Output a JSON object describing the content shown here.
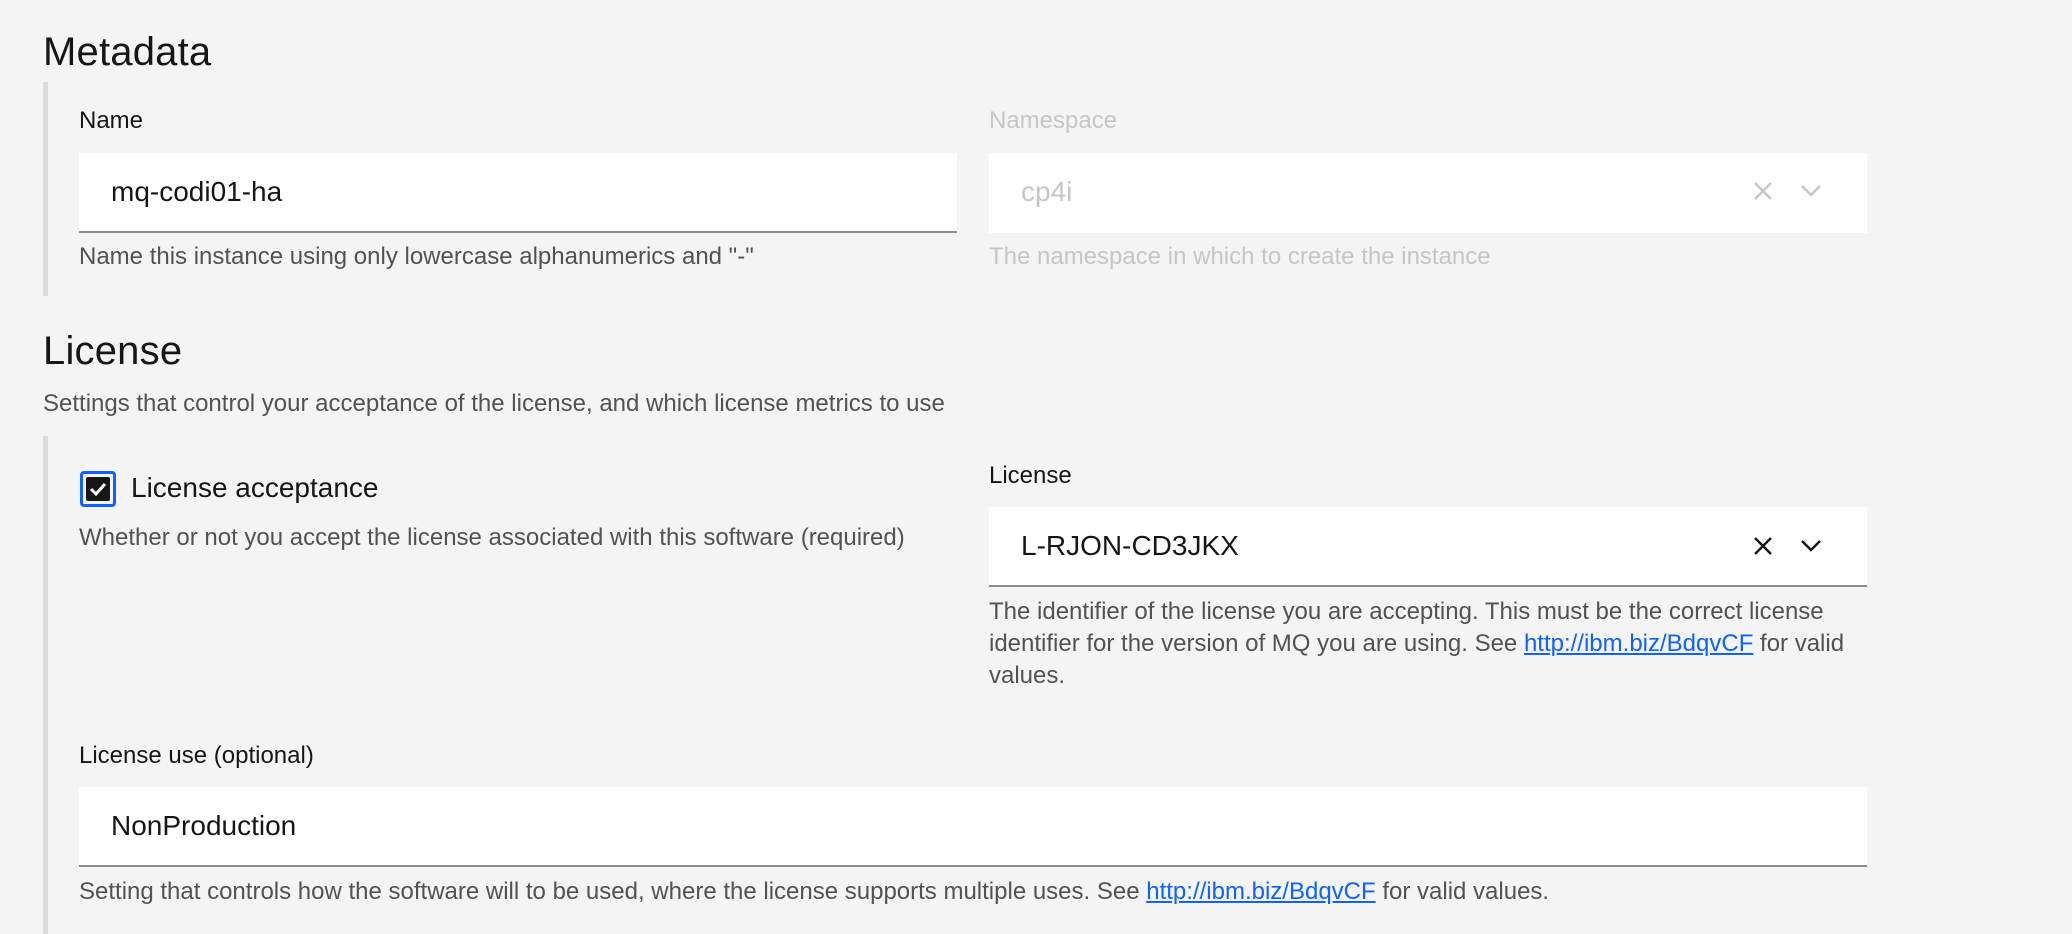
{
  "metadata": {
    "title": "Metadata",
    "name": {
      "label": "Name",
      "value": "mq-codi01-ha",
      "helper": "Name this instance using only lowercase alphanumerics and \"-\""
    },
    "namespace": {
      "label": "Namespace",
      "value": "cp4i",
      "helper": "The namespace in which to create the instance",
      "clear_icon": "close-icon",
      "dropdown_icon": "chevron-down-icon"
    }
  },
  "license": {
    "title": "License",
    "description": "Settings that control your acceptance of the license, and which license metrics to use",
    "acceptance": {
      "label": "License acceptance",
      "checked": true,
      "helper": "Whether or not you accept the license associated with this software (required)"
    },
    "license_select": {
      "label": "License",
      "value": "L-RJON-CD3JKX",
      "helper_before": "The identifier of the license you are accepting. This must be the correct license identifier for the version of MQ you are using. See ",
      "helper_link": "http://ibm.biz/BdqvCF",
      "helper_after": " for valid values.",
      "clear_icon": "close-icon",
      "dropdown_icon": "chevron-down-icon"
    },
    "use": {
      "label": "License use (optional)",
      "value": "NonProduction",
      "helper_before": "Setting that controls how the software will to be used, where the license supports multiple uses. See ",
      "helper_link": "http://ibm.biz/BdqvCF",
      "helper_after": " for valid values."
    }
  },
  "colors": {
    "background": "#f4f4f4",
    "accent": "#0f62fe",
    "text": "#161616",
    "helper_text": "#525252",
    "disabled_text": "#c6c6c6"
  }
}
